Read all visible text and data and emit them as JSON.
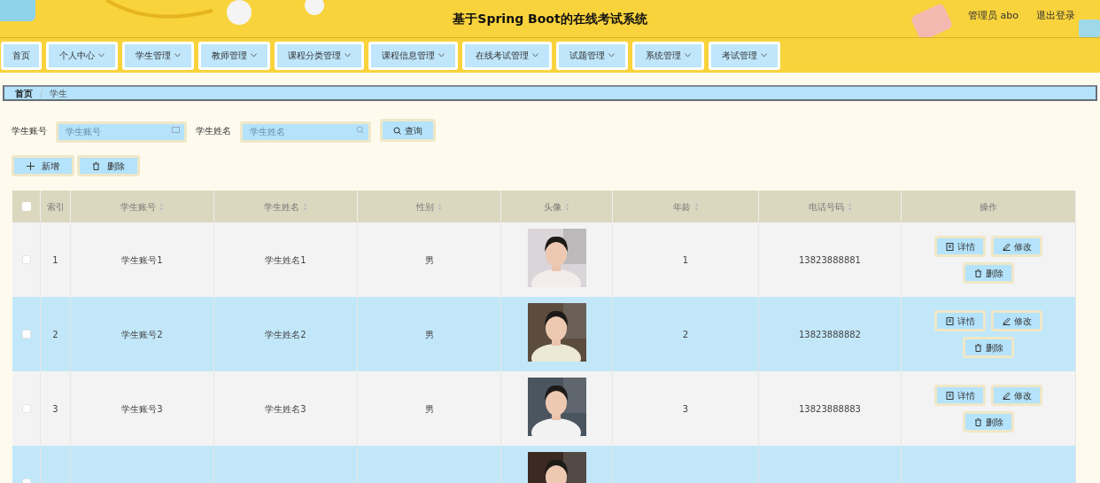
{
  "header": {
    "title": "基于Spring Boot的在线考试系统",
    "user": "管理员 abo",
    "logout": "退出登录"
  },
  "nav": [
    {
      "label": "首页",
      "dropdown": false
    },
    {
      "label": "个人中心",
      "dropdown": true
    },
    {
      "label": "学生管理",
      "dropdown": true
    },
    {
      "label": "教师管理",
      "dropdown": true
    },
    {
      "label": "课程分类管理",
      "dropdown": true
    },
    {
      "label": "课程信息管理",
      "dropdown": true
    },
    {
      "label": "在线考试管理",
      "dropdown": true
    },
    {
      "label": "试题管理",
      "dropdown": true
    },
    {
      "label": "系统管理",
      "dropdown": true
    },
    {
      "label": "考试管理",
      "dropdown": true
    }
  ],
  "breadcrumb": {
    "items": [
      "首页",
      "学生"
    ],
    "separator": "/"
  },
  "search": {
    "fields": [
      {
        "label": "学生账号",
        "placeholder": "学生账号"
      },
      {
        "label": "学生姓名",
        "placeholder": "学生姓名"
      }
    ],
    "button": "查询"
  },
  "actions": [
    {
      "kind": "add",
      "label": "新增"
    },
    {
      "kind": "delete",
      "label": "删除"
    }
  ],
  "table": {
    "select_all": {
      "checked": false
    },
    "columns": [
      {
        "label": "索引",
        "sortable": false
      },
      {
        "label": "学生账号",
        "sortable": true
      },
      {
        "label": "学生姓名",
        "sortable": true
      },
      {
        "label": "性别",
        "sortable": true
      },
      {
        "label": "头像",
        "sortable": true
      },
      {
        "label": "年龄",
        "sortable": true
      },
      {
        "label": "电话号码",
        "sortable": true
      },
      {
        "label": "操作",
        "sortable": false
      }
    ],
    "rows": [
      {
        "highlighted": false,
        "checked": false,
        "index": "1",
        "account": "学生账号1",
        "name": "学生姓名1",
        "gender": "男",
        "avatar": {
          "kind": "picture"
        },
        "age": "1",
        "phone": "13823888881",
        "actions": [
          {
            "kind": "detail",
            "label": "详情"
          },
          {
            "kind": "edit",
            "label": "修改"
          },
          {
            "kind": "delete",
            "label": "删除"
          }
        ]
      },
      {
        "highlighted": true,
        "checked": false,
        "index": "2",
        "account": "学生账号2",
        "name": "学生姓名2",
        "gender": "男",
        "avatar": {
          "kind": "picture"
        },
        "age": "2",
        "phone": "13823888882",
        "actions": [
          {
            "kind": "detail",
            "label": "详情"
          },
          {
            "kind": "edit",
            "label": "修改"
          },
          {
            "kind": "delete",
            "label": "删除"
          }
        ]
      },
      {
        "highlighted": false,
        "checked": false,
        "index": "3",
        "account": "学生账号3",
        "name": "学生姓名3",
        "gender": "男",
        "avatar": {
          "kind": "picture"
        },
        "age": "3",
        "phone": "13823888883",
        "actions": [
          {
            "kind": "detail",
            "label": "详情"
          },
          {
            "kind": "edit",
            "label": "修改"
          },
          {
            "kind": "delete",
            "label": "删除"
          }
        ]
      },
      {
        "highlighted": true,
        "checked": false,
        "avatar": {
          "kind": "picture"
        }
      }
    ]
  }
}
